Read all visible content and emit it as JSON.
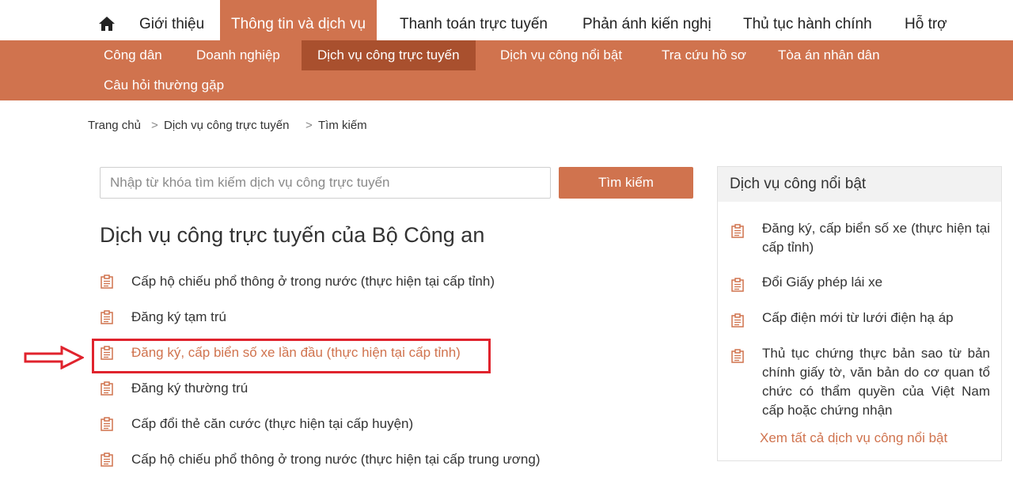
{
  "colors": {
    "accent": "#d0734e",
    "accent_dark": "#a9502e",
    "highlight": "#e0232d"
  },
  "topnav": {
    "home_icon": "home-icon",
    "items": [
      "Giới thiệu",
      "Thông tin và dịch vụ",
      "Thanh toán trực tuyến",
      "Phản ánh kiến nghị",
      "Thủ tục hành chính",
      "Hỗ trợ"
    ]
  },
  "subnav": {
    "items": [
      "Công dân",
      "Doanh nghiệp",
      "Dịch vụ công trực tuyến",
      "Dịch vụ công nổi bật",
      "Tra cứu hồ sơ",
      "Tòa án nhân dân",
      "Câu hỏi thường gặp"
    ]
  },
  "breadcrumb": [
    "Trang chủ",
    "Dịch vụ công trực tuyến",
    "Tìm kiếm"
  ],
  "breadcrumb_separator": ">",
  "search": {
    "placeholder": "Nhập từ khóa tìm kiếm dịch vụ công trực tuyến",
    "value": "",
    "button_label": "Tìm kiếm"
  },
  "main": {
    "title": "Dịch vụ công trực tuyến của Bộ Công an",
    "item_icon": "clipboard-icon",
    "services": [
      "Cấp hộ chiếu phổ thông ở trong nước (thực hiện tại cấp tỉnh)",
      "Đăng ký tạm trú",
      "Đăng ký, cấp biển số xe lần đầu (thực hiện tại cấp tỉnh)",
      "Đăng ký thường trú",
      "Cấp đổi thẻ căn cước (thực hiện tại cấp huyện)",
      "Cấp hộ chiếu phổ thông ở trong nước (thực hiện tại cấp trung ương)"
    ]
  },
  "panel": {
    "title": "Dịch vụ công nổi bật",
    "items": [
      "Đăng ký, cấp biển số xe (thực hiện tại cấp tỉnh)",
      "Đổi Giấy phép lái xe",
      "Cấp điện mới từ lưới điện hạ áp",
      "Thủ tục chứng thực bản sao từ bản chính giấy tờ, văn bản do cơ quan tổ chức có thẩm quyền của Việt Nam cấp hoặc chứng nhận"
    ],
    "more_link": "Xem tất cả dịch vụ công nổi bật"
  }
}
